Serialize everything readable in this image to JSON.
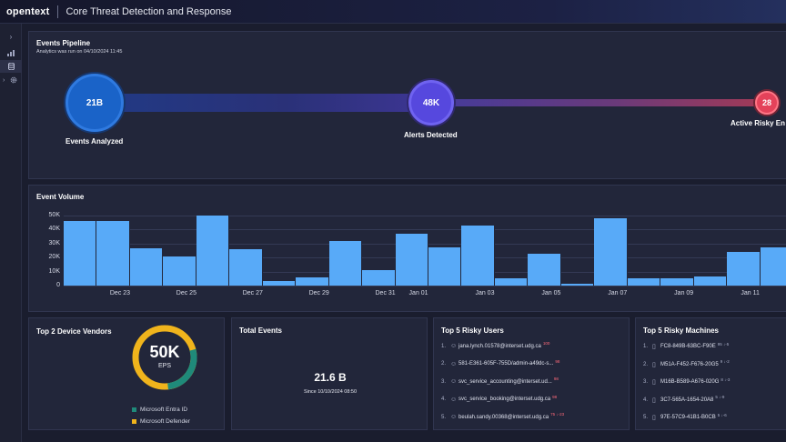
{
  "header": {
    "logo": "opentext",
    "app_title": "Core Threat Detection and Response"
  },
  "sidebar": {
    "items": [
      "chevron-right-icon",
      "bar-chart-icon",
      "database-icon",
      "gear-icon"
    ]
  },
  "pipeline": {
    "title": "Events Pipeline",
    "subtitle": "Analytics was run on 04/10/2024 11:45",
    "nodes": [
      {
        "value": "21B",
        "label": "Events Analyzed",
        "color": "#1e6fd6"
      },
      {
        "value": "48K",
        "label": "Alerts Detected",
        "color": "#5a4de0"
      },
      {
        "value": "28",
        "label": "Active Risky En",
        "color": "#e8455a"
      }
    ]
  },
  "volume": {
    "title": "Event Volume",
    "chart_data": {
      "type": "bar",
      "ylim": [
        0,
        50000
      ],
      "yticks": [
        "50K",
        "40K",
        "30K",
        "20K",
        "10K",
        "0"
      ],
      "xticks": [
        "Dec 23",
        "Dec 25",
        "Dec 27",
        "Dec 29",
        "Dec 31",
        "Jan 01",
        "Jan 03",
        "Jan 05",
        "Jan 07",
        "Jan 09",
        "Jan 11"
      ],
      "values": [
        46000,
        46000,
        26500,
        20500,
        50000,
        26000,
        3500,
        6000,
        32000,
        11000,
        37000,
        27500,
        43000,
        5000,
        23000,
        1000,
        48000,
        5000,
        5500,
        6500,
        24000,
        27000
      ]
    }
  },
  "vendors": {
    "title": "Top 2 Device Vendors",
    "center_value": "50K",
    "center_unit": "EPS",
    "legend": [
      {
        "name": "Microsoft Entra ID",
        "color": "#1f8a7a"
      },
      {
        "name": "Microsoft Defender",
        "color": "#f0b41c"
      }
    ]
  },
  "total": {
    "title": "Total Events",
    "value": "21.6 B",
    "since": "Since 10/10/2024 08:50"
  },
  "risky_users": {
    "title": "Top 5 Risky Users",
    "rows": [
      {
        "n": "1.",
        "name": "jana.lynch.01578@interset.udg.ca",
        "score": "100"
      },
      {
        "n": "2.",
        "name": "581-E361-605F-755D/admin-a49dc-s...",
        "score": "98"
      },
      {
        "n": "3.",
        "name": "svc_service_accounting@interset.ud...",
        "score": "98"
      },
      {
        "n": "4.",
        "name": "svc_service_booking@interset.udg.ca",
        "score": "98"
      },
      {
        "n": "5.",
        "name": "beulah.sandy.00368@interset.udg.ca",
        "score": "75 ↓-23"
      }
    ]
  },
  "risky_machines": {
    "title": "Top 5 Risky Machines",
    "rows": [
      {
        "n": "1.",
        "name": "FC8-849B-63BC-F90E",
        "score": "95 ↓-5"
      },
      {
        "n": "2.",
        "name": "M51A-F452-F676-20G5",
        "score": "9 ↓-2"
      },
      {
        "n": "3.",
        "name": "M16B-B589-A676-020G",
        "score": "8 ↓-3"
      },
      {
        "n": "4.",
        "name": "3C7-565A-1654-20A8",
        "score": "5 ↓-9"
      },
      {
        "n": "5.",
        "name": "97E-57C9-41B1-B0CB",
        "score": "5 ↓-6"
      }
    ]
  }
}
